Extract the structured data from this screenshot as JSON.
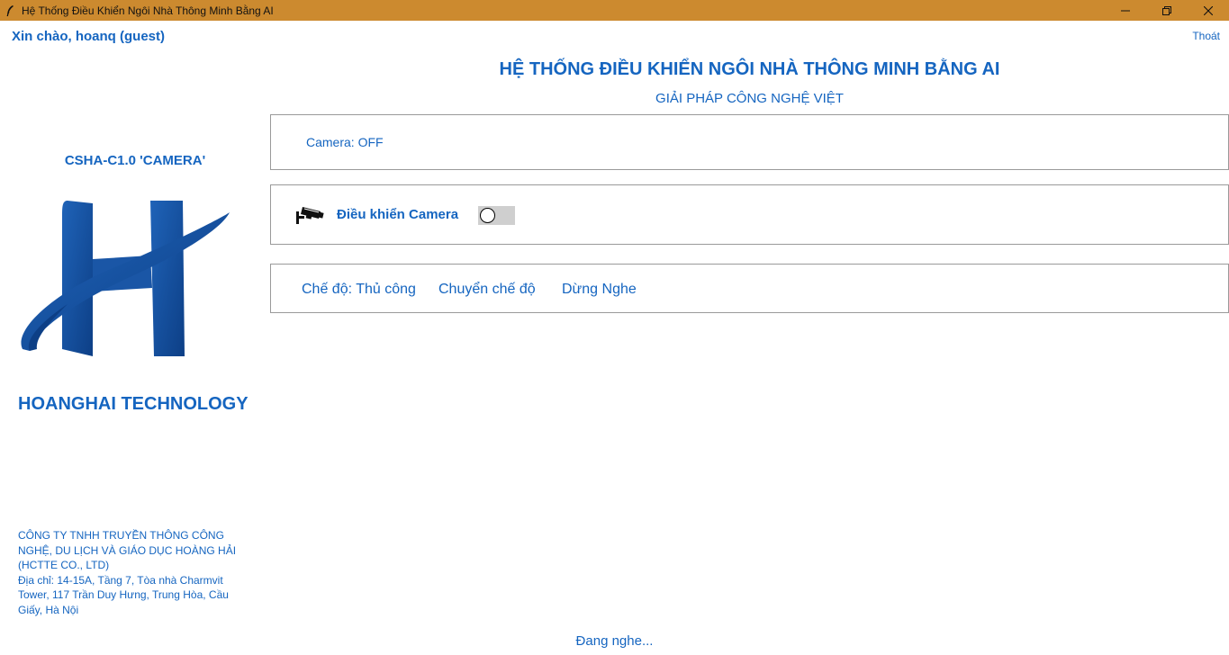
{
  "window": {
    "title": "Hệ Thống Điều Khiển Ngôi Nhà Thông Minh Bằng AI",
    "icons": {
      "app": "feather-icon",
      "minimize": "minimize-icon",
      "maximize": "restore-icon",
      "close": "close-icon"
    }
  },
  "header": {
    "greeting": "Xin chào, hoanq (guest)",
    "logout_label": "Thoát",
    "title": "HỆ THỐNG ĐIỀU KHIỂN NGÔI NHÀ THÔNG MINH BẰNG AI",
    "subtitle": "GIẢI PHÁP CÔNG NGHỆ VIỆT"
  },
  "sidebar": {
    "model": "CSHA-C1.0 'CAMERA'",
    "logo_icon": "h-swoosh-logo",
    "brand": "HOANGHAI TECHNOLOGY",
    "company_lines": [
      "CÔNG TY TNHH TRUYỀN THÔNG CÔNG",
      "NGHỆ, DU LỊCH VÀ GIÁO DỤC HOÀNG HẢI",
      "(HCTTE CO., LTD)",
      "Địa chỉ: 14-15A, Tầng 7, Tòa nhà Charmvit",
      "Tower, 117 Trần Duy Hưng, Trung Hòa, Cầu",
      "Giấy, Hà Nội"
    ]
  },
  "status_panel": {
    "camera_status": "Camera: OFF"
  },
  "control_panel": {
    "icon": "cctv-camera-icon",
    "label": "Điều khiển Camera",
    "toggle_on": false
  },
  "mode_panel": {
    "current_mode": "Chế độ: Thủ công",
    "switch_label": "Chuyển chế độ",
    "stop_label": "Dừng Nghe"
  },
  "footer": {
    "listening": "Đang nghe..."
  },
  "colors": {
    "titlebar": "#cc8a2f",
    "accent": "#1565c0",
    "border": "#9a9a9a",
    "toggle_track": "#cfcfcf"
  }
}
